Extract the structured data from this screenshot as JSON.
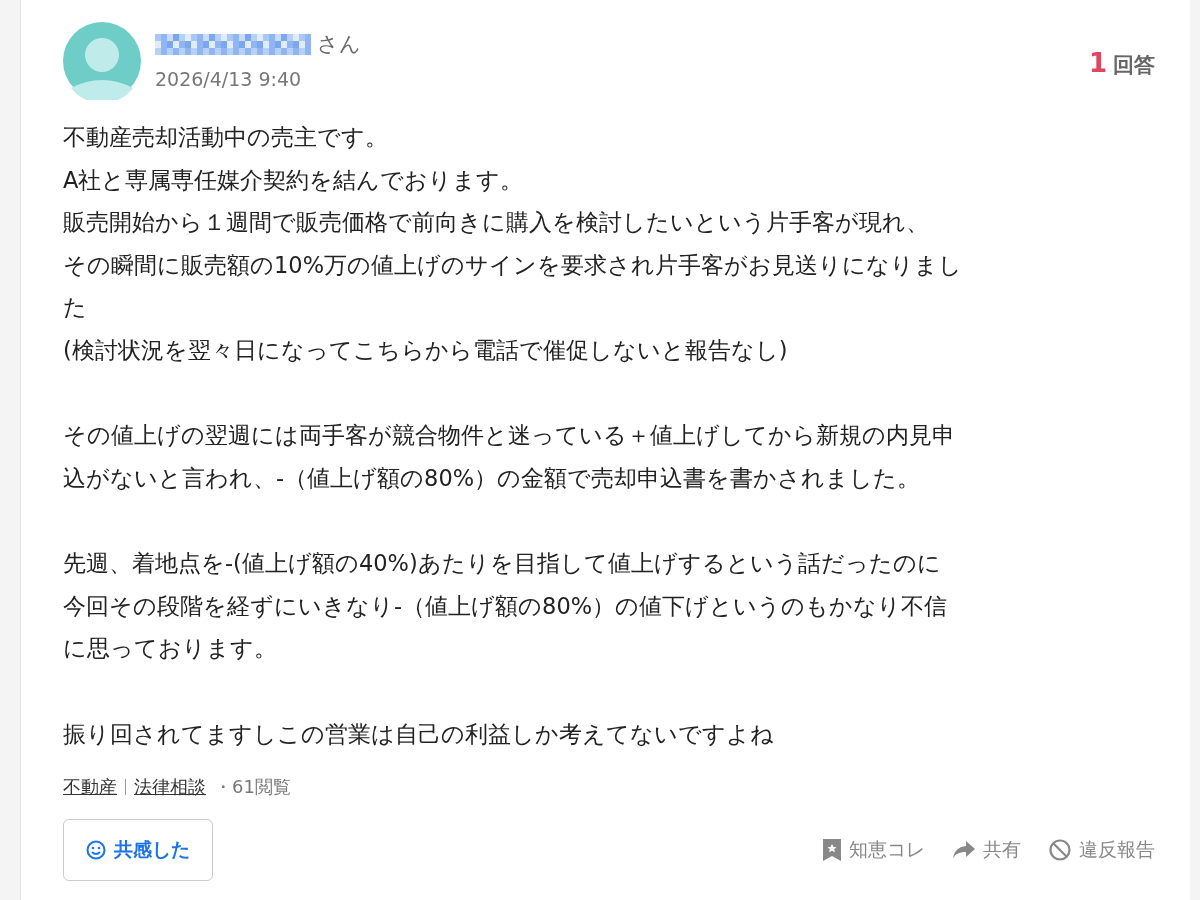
{
  "question": {
    "honorific": "さん",
    "date": "2026/4/13 9:40",
    "answer_count": "1",
    "answer_label": "回答",
    "paragraphs": [
      {
        "lines": [
          "不動産売却活動中の売主です。",
          "A社と専属専任媒介契約を結んでおります。",
          "販売開始から１週間で販売価格で前向きに購入を検討したいという片手客が現れ、",
          "その瞬間に販売額の10%万の値上げのサインを要求され片手客がお見送りになりまし",
          "た",
          "(検討状況を翌々日になってこちらから電話で催促しないと報告なし)"
        ]
      },
      {
        "lines": [
          "その値上げの翌週には両手客が競合物件と迷っている＋値上げしてから新規の内見申",
          "込がないと言われ、-（値上げ額の80%）の金額で売却申込書を書かされました。"
        ]
      },
      {
        "lines": [
          "先週、着地点を-(値上げ額の40%)あたりを目指して値上げするという話だったのに",
          "今回その段階を経ずにいきなり-（値上げ額の80%）の値下げというのもかなり不信",
          "に思っております。"
        ]
      },
      {
        "lines": [
          "振り回されてますしこの営業は自己の利益しか考えてないですよね"
        ]
      }
    ],
    "categories": [
      "不動産",
      "法律相談"
    ],
    "views": "・61閲覧",
    "empathy_button": "共感した",
    "actions": [
      {
        "kind": "bookmark",
        "label": "知恵コレ"
      },
      {
        "kind": "share",
        "label": "共有"
      },
      {
        "kind": "report",
        "label": "違反報告"
      }
    ]
  }
}
